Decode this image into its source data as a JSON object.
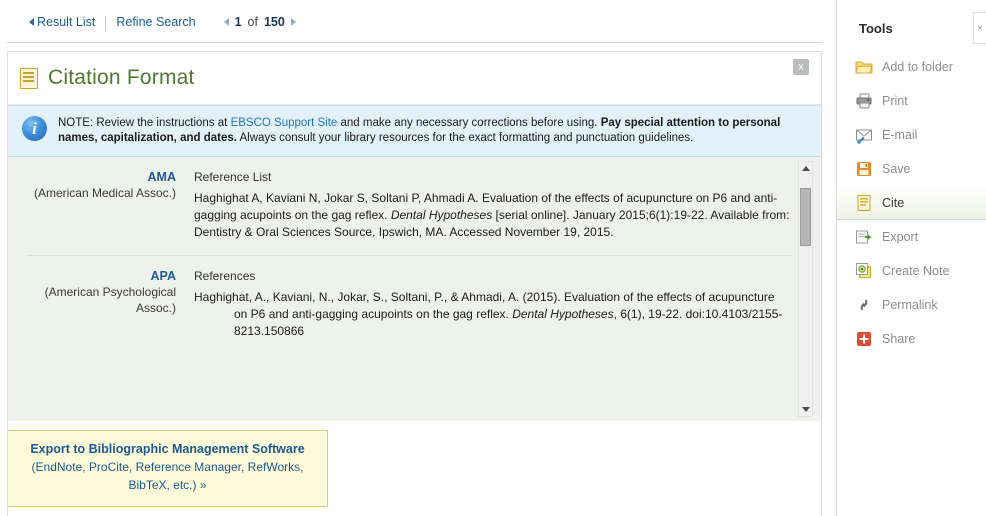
{
  "topnav": {
    "result_list": "Result List",
    "refine_search": "Refine Search",
    "pager_current": "1",
    "pager_of": "of",
    "pager_total": "150",
    "prev_icon": "triangle-left-icon",
    "next_icon": "triangle-right-icon"
  },
  "card": {
    "title": "Citation Format",
    "title_icon": "document-icon",
    "close_label": "x",
    "note": {
      "icon": "info-icon",
      "part1": "NOTE: Review the instructions at ",
      "link": "EBSCO Support Site",
      "part2": " and make any necessary corrections before using. ",
      "bold": "Pay special attention to personal names, capitalization, and dates.",
      "part3": " Always consult your library resources for the exact formatting and punctuation guidelines."
    },
    "citations": [
      {
        "abbr": "AMA",
        "full": "(American Medical Assoc.)",
        "label": "Reference List",
        "text_pre": "Haghighat A, Kaviani N, Jokar S, Soltani P, Ahmadi A. Evaluation of the effects of acupuncture on P6 and anti-gagging acupoints on the gag reflex. ",
        "text_italic": "Dental Hypotheses",
        "text_post": " [serial online]. January 2015;6(1):19-22. Available from: Dentistry & Oral Sciences Source, Ipswich, MA. Accessed November 19, 2015."
      },
      {
        "abbr": "APA",
        "full": "(American Psychological Assoc.)",
        "label": "References",
        "text_pre": "Haghighat, A., Kaviani, N., Jokar, S., Soltani, P., & Ahmadi, A. (2015). Evaluation of the effects of acupuncture on P6 and anti-gagging acupoints on the gag reflex. ",
        "text_italic": "Dental Hypotheses",
        "text_post": ", 6(1), 19-22. doi:10.4103/2155-8213.150866",
        "hanging": true
      }
    ],
    "scrollbar": {
      "up_icon": "scroll-up-arrow-icon",
      "down_icon": "scroll-down-arrow-icon"
    },
    "export": {
      "title": "Export to Bibliographic Management Software",
      "subtitle": "(EndNote, ProCite, Reference Manager, RefWorks, BibTeX, etc.) »"
    }
  },
  "tools": {
    "title": "Tools",
    "close_label": "×",
    "items": [
      {
        "label": "Add to folder",
        "icon": "folder-icon",
        "active": false
      },
      {
        "label": "Print",
        "icon": "printer-icon",
        "active": false
      },
      {
        "label": "E-mail",
        "icon": "envelope-icon",
        "active": false
      },
      {
        "label": "Save",
        "icon": "floppy-disk-icon",
        "active": false
      },
      {
        "label": "Cite",
        "icon": "cite-document-icon",
        "active": true
      },
      {
        "label": "Export",
        "icon": "export-icon",
        "active": false
      },
      {
        "label": "Create Note",
        "icon": "note-icon",
        "active": false
      },
      {
        "label": "Permalink",
        "icon": "link-icon",
        "active": false
      },
      {
        "label": "Share",
        "icon": "share-plus-icon",
        "active": false
      }
    ]
  },
  "colors": {
    "link_blue": "#1d5a93",
    "title_green": "#4e7a2d",
    "note_bg": "#e3f1fb",
    "cite_bg": "#eef1ec",
    "export_bg": "#fdfbd9"
  }
}
